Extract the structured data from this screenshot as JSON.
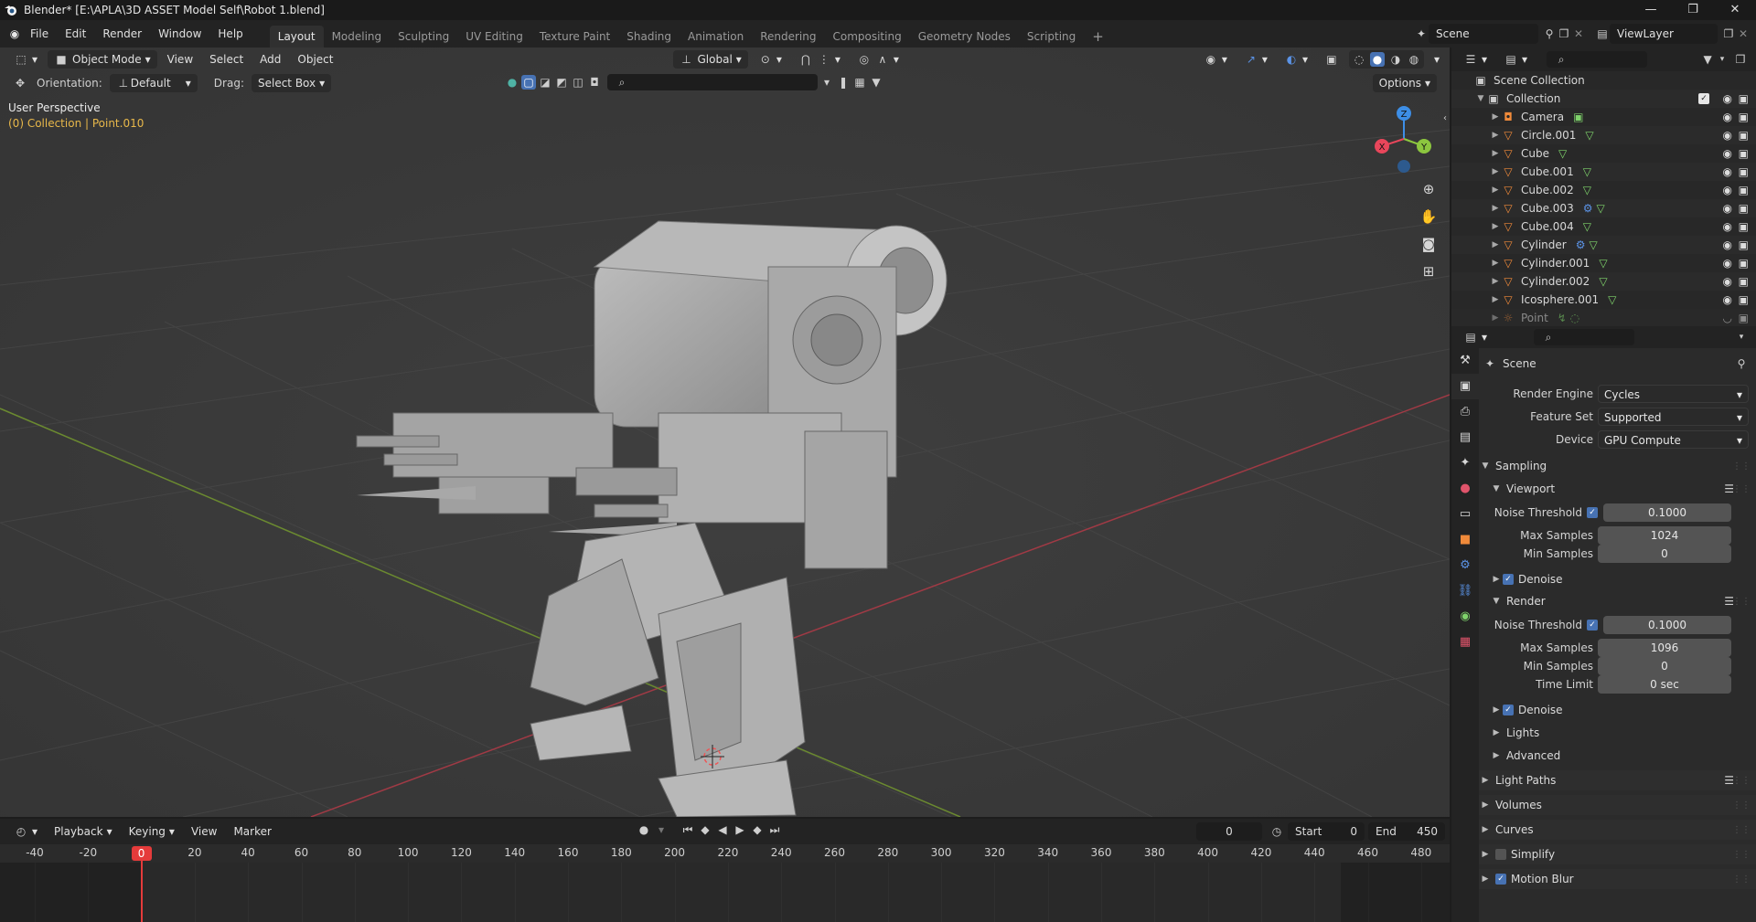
{
  "titlebar": {
    "title": "Blender* [E:\\APLA\\3D ASSET Model Self\\Robot 1.blend]",
    "controls": [
      "—",
      "❐",
      "✕"
    ]
  },
  "menu": [
    "File",
    "Edit",
    "Render",
    "Window",
    "Help"
  ],
  "workspaces": [
    "Layout",
    "Modeling",
    "Sculpting",
    "UV Editing",
    "Texture Paint",
    "Shading",
    "Animation",
    "Rendering",
    "Compositing",
    "Geometry Nodes",
    "Scripting"
  ],
  "workspace_add": "+",
  "active_workspace": "Layout",
  "scene_field": "Scene",
  "viewlayer_field": "ViewLayer",
  "viewport": {
    "mode": "Object Mode",
    "menus": [
      "View",
      "Select",
      "Add",
      "Object"
    ],
    "transform_orientation": "Global",
    "orientation_label": "Orientation:",
    "orientation_value": "Default",
    "drag_label": "Drag:",
    "drag_value": "Select Box",
    "options_label": "Options",
    "perspective": "User Perspective",
    "collection_info": "(0) Collection | Point.010",
    "gizmo": {
      "x": "X",
      "y": "Y",
      "z": "Z"
    }
  },
  "timeline": {
    "menus": [
      "Playback",
      "Keying",
      "View",
      "Marker"
    ],
    "current_frame": "0",
    "start_label": "Start",
    "start_value": "0",
    "end_label": "End",
    "end_value": "450",
    "ruler_ticks": [
      "-40",
      "-20",
      "0",
      "20",
      "40",
      "60",
      "80",
      "100",
      "120",
      "140",
      "160",
      "180",
      "200",
      "220",
      "240",
      "260",
      "280",
      "300",
      "320",
      "340",
      "360",
      "380",
      "400",
      "420",
      "440",
      "460",
      "480"
    ],
    "playhead": "0"
  },
  "outliner": {
    "root": "Scene Collection",
    "collection": "Collection",
    "items": [
      {
        "name": "Camera",
        "type": "camera",
        "extra": "camera-data"
      },
      {
        "name": "Circle.001",
        "type": "mesh",
        "extra": "mesh"
      },
      {
        "name": "Cube",
        "type": "mesh",
        "extra": "mesh"
      },
      {
        "name": "Cube.001",
        "type": "mesh",
        "extra": "mesh"
      },
      {
        "name": "Cube.002",
        "type": "mesh",
        "extra": "mesh"
      },
      {
        "name": "Cube.003",
        "type": "mesh",
        "extra": "modifier+mesh"
      },
      {
        "name": "Cube.004",
        "type": "mesh",
        "extra": "mesh"
      },
      {
        "name": "Cylinder",
        "type": "mesh",
        "extra": "modifier+mesh"
      },
      {
        "name": "Cylinder.001",
        "type": "mesh",
        "extra": "mesh"
      },
      {
        "name": "Cylinder.002",
        "type": "mesh",
        "extra": "mesh"
      },
      {
        "name": "Icosphere.001",
        "type": "mesh",
        "extra": "mesh"
      },
      {
        "name": "Point",
        "type": "light",
        "extra": "light"
      }
    ]
  },
  "properties": {
    "context": "Scene",
    "render_engine_label": "Render Engine",
    "render_engine": "Cycles",
    "feature_set_label": "Feature Set",
    "feature_set": "Supported",
    "device_label": "Device",
    "device": "GPU Compute",
    "sampling": "Sampling",
    "viewport_panel": "Viewport",
    "vp_noise_label": "Noise Threshold",
    "vp_noise": "0.1000",
    "vp_max_label": "Max Samples",
    "vp_max": "1024",
    "vp_min_label": "Min Samples",
    "vp_min": "0",
    "denoise_label": "Denoise",
    "render_panel": "Render",
    "r_noise_label": "Noise Threshold",
    "r_noise": "0.1000",
    "r_max_label": "Max Samples",
    "r_max": "1096",
    "r_min_label": "Min Samples",
    "r_min": "0",
    "time_limit_label": "Time Limit",
    "time_limit": "0 sec",
    "denoise2_label": "Denoise",
    "lights": "Lights",
    "advanced": "Advanced",
    "light_paths": "Light Paths",
    "volumes": "Volumes",
    "curves": "Curves",
    "simplify": "Simplify",
    "motion_blur": "Motion Blur"
  },
  "colors": {
    "accent": "#4772b3",
    "object_orange": "#f08a3a",
    "mesh_green": "#7fd36b",
    "playhead_red": "#e53b3b",
    "axis_x": "#e8465b",
    "axis_y": "#8cc63f",
    "axis_z": "#3d8ee6",
    "active_text": "#e8b84a"
  }
}
